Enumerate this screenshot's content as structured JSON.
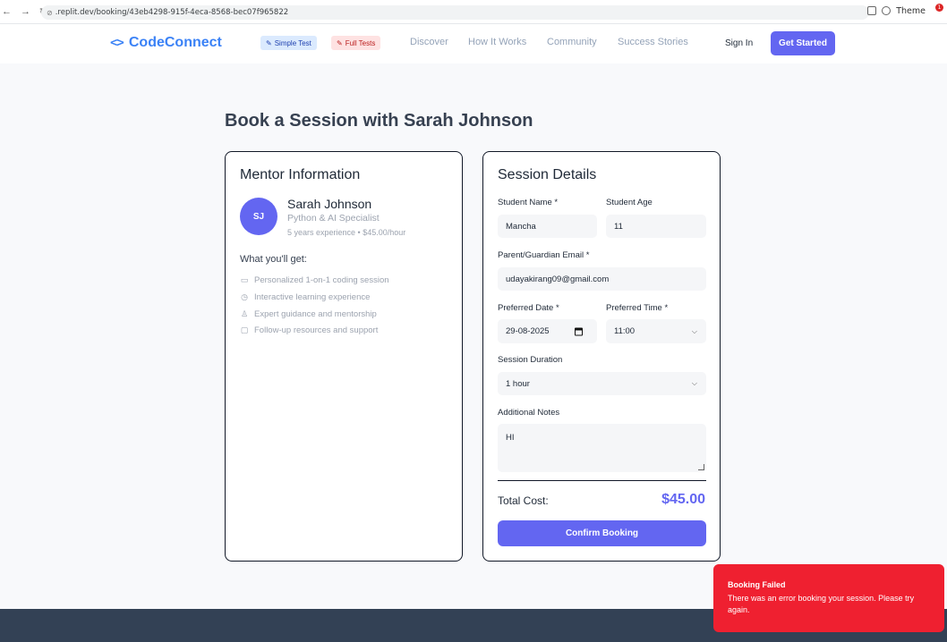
{
  "browser": {
    "url": ".replit.dev/booking/43eb4298-915f-4eca-8568-bec07f965822",
    "theme_label": "Theme",
    "notification_count": "1"
  },
  "header": {
    "logo_text": "CodeConnect",
    "badges": [
      {
        "label": "Simple Test",
        "icon": "pencil-icon"
      },
      {
        "label": "Full Tests",
        "icon": "pencil-icon"
      }
    ],
    "nav": [
      "Discover",
      "How It Works",
      "Community",
      "Success Stories"
    ],
    "sign_in": "Sign In",
    "get_started": "Get Started"
  },
  "page": {
    "title": "Book a Session with Sarah Johnson"
  },
  "mentor": {
    "card_title": "Mentor Information",
    "initials": "SJ",
    "name": "Sarah Johnson",
    "specialty": "Python & AI Specialist",
    "meta": "5 years experience • $45.00/hour",
    "benefits_title": "What you'll get:",
    "benefits": [
      {
        "icon": "calendar-icon",
        "text": "Personalized 1-on-1 coding session"
      },
      {
        "icon": "clock-icon",
        "text": "Interactive learning experience"
      },
      {
        "icon": "user-icon",
        "text": "Expert guidance and mentorship"
      },
      {
        "icon": "message-icon",
        "text": "Follow-up resources and support"
      }
    ]
  },
  "session": {
    "card_title": "Session Details",
    "student_name_label": "Student Name *",
    "student_name_value": "Mancha",
    "student_age_label": "Student Age",
    "student_age_value": "11",
    "email_label": "Parent/Guardian Email *",
    "email_value": "udayakirang09@gmail.com",
    "date_label": "Preferred Date *",
    "date_value": "29-08-2025",
    "time_label": "Preferred Time *",
    "time_value": "11:00",
    "duration_label": "Session Duration",
    "duration_value": "1 hour",
    "notes_label": "Additional Notes",
    "notes_value": "HI",
    "total_label": "Total Cost:",
    "total_value": "$45.00",
    "confirm_label": "Confirm Booking"
  },
  "toast": {
    "title": "Booking Failed",
    "message": "There was an error booking your session. Please try again."
  },
  "colors": {
    "accent": "#6366f1",
    "logo": "#3b82f6",
    "error": "#ef2030",
    "footer": "#334155"
  }
}
